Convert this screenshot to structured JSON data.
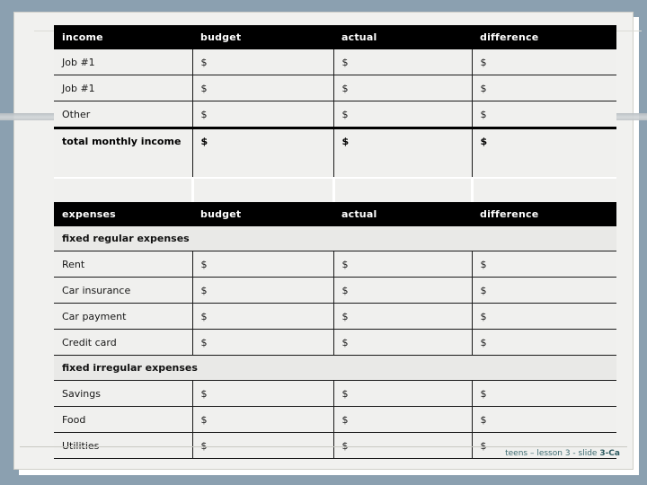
{
  "slide": {
    "footer_prefix": "teens – lesson 3 - slide ",
    "footer_slide_id": "3-Ca"
  },
  "income_table": {
    "headers": [
      "income",
      "budget",
      "actual",
      "difference"
    ],
    "rows": [
      {
        "label": "Job #1",
        "budget": "$",
        "actual": "$",
        "difference": "$"
      },
      {
        "label": "Job #1",
        "budget": "$",
        "actual": "$",
        "difference": "$"
      },
      {
        "label": "Other",
        "budget": "$",
        "actual": "$",
        "difference": "$"
      }
    ],
    "total": {
      "label": "total monthly income",
      "budget": "$",
      "actual": "$",
      "difference": "$"
    }
  },
  "expenses_table": {
    "headers": [
      "expenses",
      "budget",
      "actual",
      "difference"
    ],
    "sections": [
      {
        "title": "fixed regular expenses",
        "rows": [
          {
            "label": "Rent",
            "budget": "$",
            "actual": "$",
            "difference": "$"
          },
          {
            "label": "Car insurance",
            "budget": "$",
            "actual": "$",
            "difference": "$"
          },
          {
            "label": "Car payment",
            "budget": "$",
            "actual": "$",
            "difference": "$"
          },
          {
            "label": "Credit card",
            "budget": "$",
            "actual": "$",
            "difference": "$"
          }
        ]
      },
      {
        "title": "fixed irregular expenses",
        "rows": [
          {
            "label": "Savings",
            "budget": "$",
            "actual": "$",
            "difference": "$"
          },
          {
            "label": "Food",
            "budget": "$",
            "actual": "$",
            "difference": "$"
          },
          {
            "label": "Utilities",
            "budget": "$",
            "actual": "$",
            "difference": "$"
          }
        ]
      }
    ]
  },
  "colors": {
    "slide_background": "#8ba0b0",
    "panel": "#f1f1ef",
    "header_bar": "#000000",
    "cell": "#f0f0ee",
    "section_row": "#e9e9e7",
    "footer_text": "#3c6a70"
  }
}
